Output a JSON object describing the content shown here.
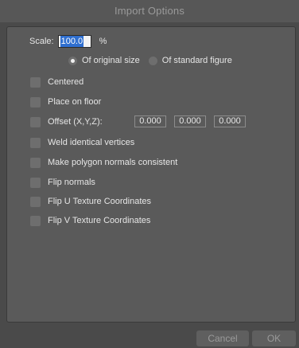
{
  "window": {
    "title": "Import Options"
  },
  "scale": {
    "label": "Scale:",
    "value": "100.0",
    "unit": "%"
  },
  "size_reference": {
    "options": [
      {
        "label": "Of original size",
        "selected": true
      },
      {
        "label": "Of standard figure",
        "selected": false
      }
    ]
  },
  "options": {
    "centered": {
      "label": "Centered",
      "checked": false
    },
    "place_on_floor": {
      "label": "Place on floor",
      "checked": false
    },
    "offset": {
      "label": "Offset (X,Y,Z):",
      "checked": false,
      "x": "0.000",
      "y": "0.000",
      "z": "0.000"
    },
    "weld": {
      "label": "Weld identical vertices",
      "checked": false
    },
    "make_consistent": {
      "label": "Make polygon normals consistent",
      "checked": false
    },
    "flip_normals": {
      "label": "Flip normals",
      "checked": false
    },
    "flip_u": {
      "label": "Flip U Texture Coordinates",
      "checked": false
    },
    "flip_v": {
      "label": "Flip V Texture Coordinates",
      "checked": false
    }
  },
  "buttons": {
    "cancel": "Cancel",
    "ok": "OK"
  },
  "colors": {
    "background": "#4a4a4a",
    "panel": "#5a5a5a",
    "control": "#6e6e6e",
    "selection": "#2f6fd0",
    "text": "#e6e6e6",
    "muted_text": "#9a9a9a"
  }
}
